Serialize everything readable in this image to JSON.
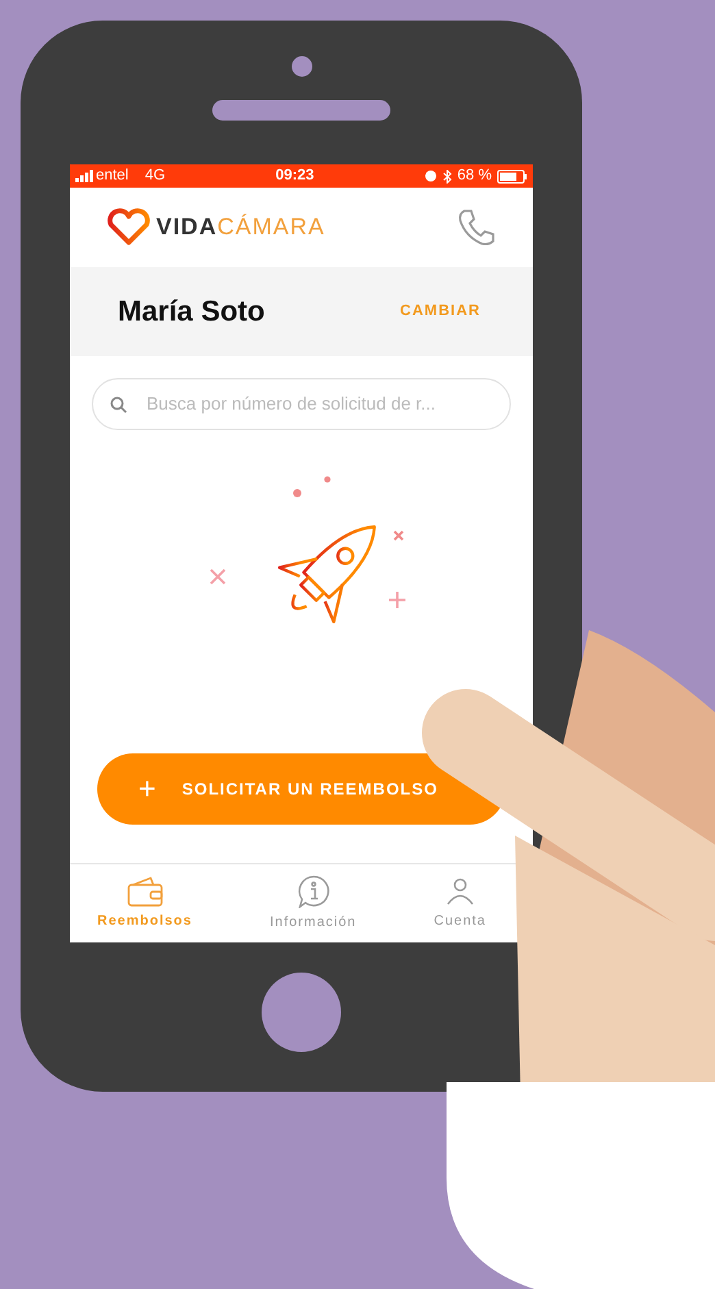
{
  "status_bar": {
    "carrier": "entel",
    "network": "4G",
    "time": "09:23",
    "battery": "68 %"
  },
  "header": {
    "logo_bold": "VIDA",
    "logo_light": "CÁMARA"
  },
  "account": {
    "name": "María Soto",
    "action": "CAMBIAR"
  },
  "search": {
    "placeholder": "Busca por número de solicitud de r..."
  },
  "primary_button": {
    "icon": "+",
    "label": "SOLICITAR UN REEMBOLSO"
  },
  "tabs": [
    {
      "label": "Reembolsos",
      "kind": "wallet",
      "selected": true
    },
    {
      "label": "Información",
      "kind": "info",
      "selected": false
    },
    {
      "label": "Cuenta",
      "kind": "user",
      "selected": false
    }
  ]
}
